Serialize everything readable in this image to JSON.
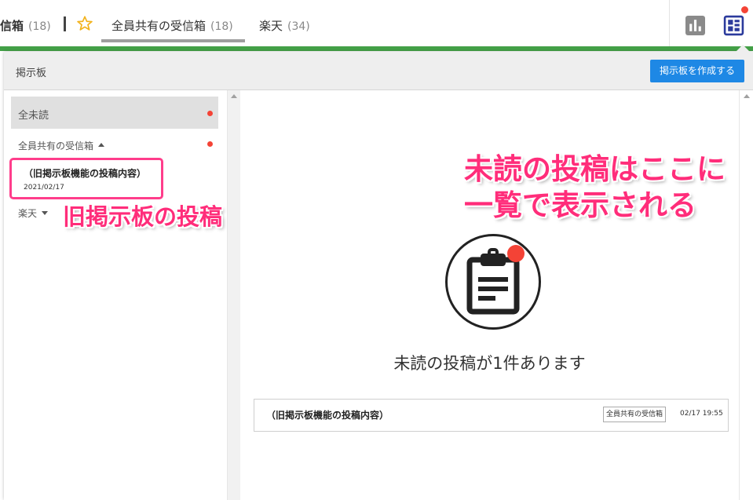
{
  "topbar": {
    "tabs": [
      {
        "label": "信箱",
        "count": "(18)"
      },
      {
        "label": "全員共有の受信箱",
        "count": "(18)"
      },
      {
        "label": "楽天",
        "count": "(34)"
      }
    ]
  },
  "panel": {
    "title": "掲示板",
    "create_button": "掲示板を作成する"
  },
  "sidebar": {
    "unread_all": "全未読",
    "shared_inbox": "全員共有の受信箱",
    "post": {
      "title": "（旧掲示板機能の投稿内容）",
      "date": "2021/02/17"
    },
    "rakuten": "楽天"
  },
  "annotations": {
    "old_board": "旧掲示板の投稿",
    "unread_line1": "未読の投稿はここに",
    "unread_line2": "一覧で表示される"
  },
  "main": {
    "empty_message": "未読の投稿が1件あります",
    "post": {
      "title": "（旧掲示板機能の投稿内容）",
      "tag": "全員共有の受信箱",
      "time": "02/17 19:55"
    }
  },
  "colors": {
    "accent_green": "#43a047",
    "button_blue": "#1e88e5",
    "annotation_pink": "#ff2d7a",
    "unread_red": "#f44336"
  },
  "icons": [
    "star-icon",
    "bar-chart-icon",
    "board-icon",
    "clipboard-icon",
    "caret-up-icon",
    "caret-down-icon"
  ]
}
